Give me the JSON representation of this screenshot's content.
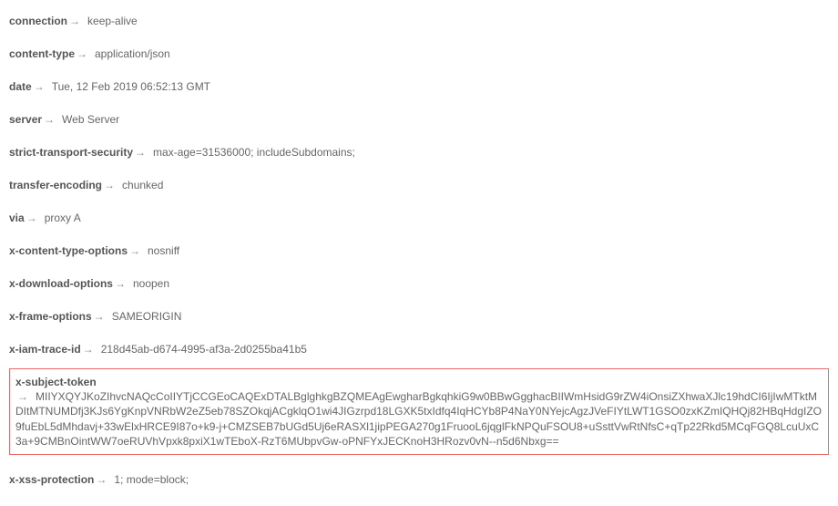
{
  "arrow": "→",
  "headers": [
    {
      "key": "connection",
      "value": "keep-alive",
      "highlighted": false
    },
    {
      "key": "content-type",
      "value": "application/json",
      "highlighted": false
    },
    {
      "key": "date",
      "value": "Tue, 12 Feb 2019 06:52:13 GMT",
      "highlighted": false
    },
    {
      "key": "server",
      "value": "Web Server",
      "highlighted": false
    },
    {
      "key": "strict-transport-security",
      "value": "max-age=31536000; includeSubdomains;",
      "highlighted": false
    },
    {
      "key": "transfer-encoding",
      "value": "chunked",
      "highlighted": false
    },
    {
      "key": "via",
      "value": "proxy A",
      "highlighted": false
    },
    {
      "key": "x-content-type-options",
      "value": "nosniff",
      "highlighted": false
    },
    {
      "key": "x-download-options",
      "value": "noopen",
      "highlighted": false
    },
    {
      "key": "x-frame-options",
      "value": "SAMEORIGIN",
      "highlighted": false
    },
    {
      "key": "x-iam-trace-id",
      "value": "218d45ab-d674-4995-af3a-2d0255ba41b5",
      "highlighted": false
    },
    {
      "key": "x-subject-token",
      "value": "MIIYXQYJKoZIhvcNAQcCoIIYTjCCGEoCAQExDTALBglghkgBZQMEAgEwgharBgkqhkiG9w0BBwGgghacBIIWmHsidG9rZW4iOnsiZXhwaXJlc19hdCI6IjIwMTktMDItMTNUMDfj3KJs6YgKnpVNRbW2eZ5eb78SZOkqjACgklqO1wi4JIGzrpd18LGXK5txIdfq4IqHCYb8P4NaY0NYejcAgzJVeFIYtLWT1GSO0zxKZmIQHQj82HBqHdgIZO9fuEbL5dMhdavj+33wElxHRCE9I87o+k9-j+CMZSEB7bUGd5Uj6eRASXl1jipPEGA270g1FruooL6jqglFkNPQuFSOU8+uSsttVwRtNfsC+qTp22Rkd5MCqFGQ8LcuUxC3a+9CMBnOintWW7oeRUVhVpxk8pxiX1wTEboX-RzT6MUbpvGw-oPNFYxJECKnoH3HRozv0vN--n5d6Nbxg==",
      "highlighted": true
    },
    {
      "key": "x-xss-protection",
      "value": "1; mode=block;",
      "highlighted": false
    }
  ]
}
